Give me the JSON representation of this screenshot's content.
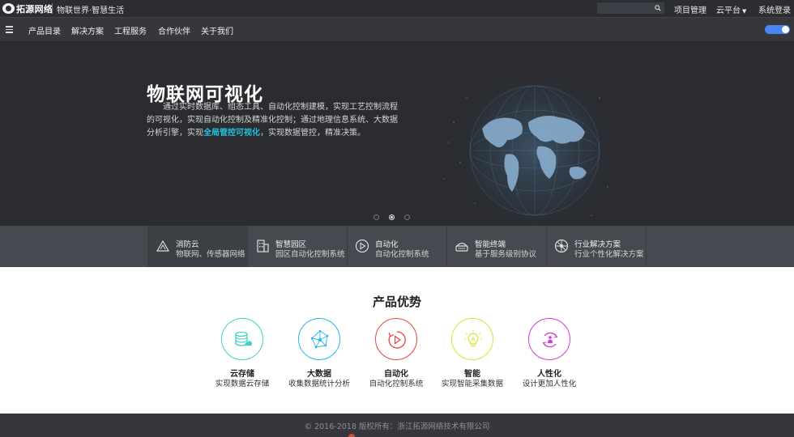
{
  "topbar": {
    "logo_text": "拓源网络",
    "slogan": "物联世界·智慧生活",
    "search_placeholder": "",
    "links": [
      "项目管理",
      "云平台",
      "系统登录"
    ]
  },
  "nav": {
    "items": [
      "产品目录",
      "解决方案",
      "工程服务",
      "合作伙伴",
      "关于我们"
    ]
  },
  "hero": {
    "title": "物联网可视化",
    "text_before": "通过实时数据库、组态工具、自动化控制建模，实现工艺控制流程的可视化，实现自动化控制及精准化控制；通过地理信息系统、大数据分析引擎，实现",
    "highlight": "全局管控可视化",
    "text_after": "，实现数据管控，精准决策。",
    "slides": 3,
    "active_slide": 2
  },
  "features": [
    {
      "title": "消防云",
      "sub": "物联网、传感器网络",
      "icon": "fire-cloud-icon"
    },
    {
      "title": "智慧园区",
      "sub": "园区自动化控制系统",
      "icon": "building-icon"
    },
    {
      "title": "自动化",
      "sub": "自动化控制系统",
      "icon": "play-circle-icon"
    },
    {
      "title": "智能终端",
      "sub": "基于服务级别协议",
      "icon": "terminal-icon"
    },
    {
      "title": "行业解决方案",
      "sub": "行业个性化解决方案",
      "icon": "industry-icon"
    }
  ],
  "advantages": {
    "title": "产品优势",
    "items": [
      {
        "name": "云存储",
        "desc": "实现数据云存储",
        "color": "#3fd3c4",
        "icon": "database-icon"
      },
      {
        "name": "大数据",
        "desc": "收集数据统计分析",
        "color": "#28b8e6",
        "icon": "network-icon"
      },
      {
        "name": "自动化",
        "desc": "自动化控制系统",
        "color": "#e8453c",
        "icon": "play-icon"
      },
      {
        "name": "智能",
        "desc": "实现智能采集数据",
        "color": "#d8e22a",
        "icon": "bulb-icon"
      },
      {
        "name": "人性化",
        "desc": "设计更加人性化",
        "color": "#cc3fd0",
        "icon": "person-icon"
      }
    ]
  },
  "footer": {
    "copyright": "© 2016-2018 版权所有：浙江拓源网络技术有限公司"
  },
  "colors": {
    "topbar": "#2b2d31",
    "nav": "#35373c",
    "hero": "#2a2c30",
    "strip": "#46494f",
    "accent": "#22c3e0",
    "toggle": "#4a86f2"
  }
}
